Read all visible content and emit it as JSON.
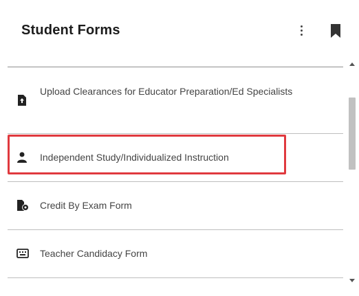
{
  "header": {
    "title": "Student Forms",
    "icons": [
      "more-vertical-icon",
      "bookmark-icon"
    ]
  },
  "forms": [
    {
      "label": "Upload Clearances for Educator Preparation/Ed Specialists",
      "icon": "file-upload-icon"
    },
    {
      "label": "Independent Study/Individualized Instruction",
      "icon": "person-icon",
      "highlighted": true
    },
    {
      "label": "Credit By Exam Form",
      "icon": "file-settings-icon"
    },
    {
      "label": "Teacher Candidacy Form",
      "icon": "keyboard-icon"
    }
  ],
  "colors": {
    "highlight": "#e0393e",
    "icon": "#222222",
    "text": "#444444"
  }
}
